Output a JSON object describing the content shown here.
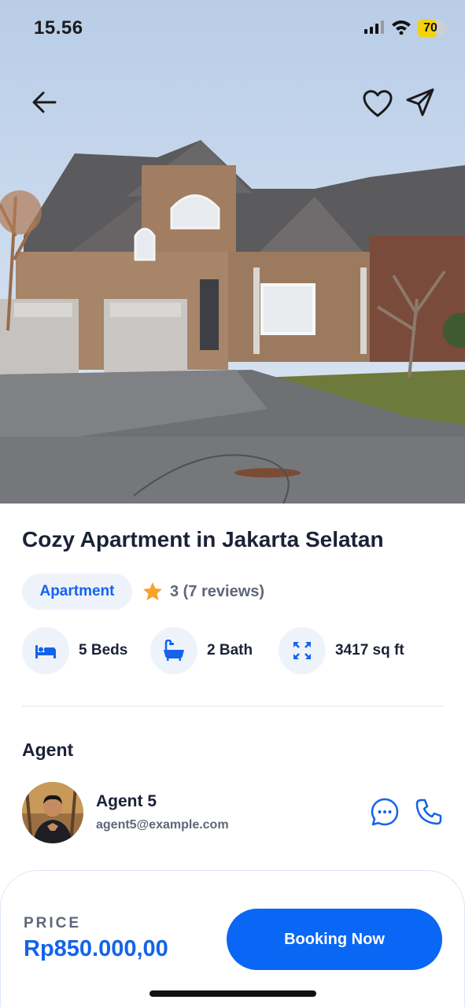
{
  "status_bar": {
    "time": "15.56",
    "battery": "70",
    "battery_level": 0.7,
    "battery_color": "#f5d10d"
  },
  "listing": {
    "title": "Cozy Apartment in Jakarta Selatan",
    "category": "Apartment",
    "rating": "3 (7 reviews)",
    "features": [
      {
        "icon": "bed-icon",
        "label": "5 Beds"
      },
      {
        "icon": "bathtub-icon",
        "label": "2 Bath"
      },
      {
        "icon": "expand-icon",
        "label": "3417 sq ft"
      }
    ]
  },
  "agent": {
    "heading": "Agent",
    "name": "Agent 5",
    "email": "agent5@example.com"
  },
  "booking": {
    "price_label": "PRICE",
    "price": "Rp850.000,00",
    "button_label": "Booking Now"
  },
  "colors": {
    "accent": "#0a66f5",
    "accent_text": "#1463ea",
    "chip_bg": "#eef3fb",
    "star": "#f7a32b"
  }
}
